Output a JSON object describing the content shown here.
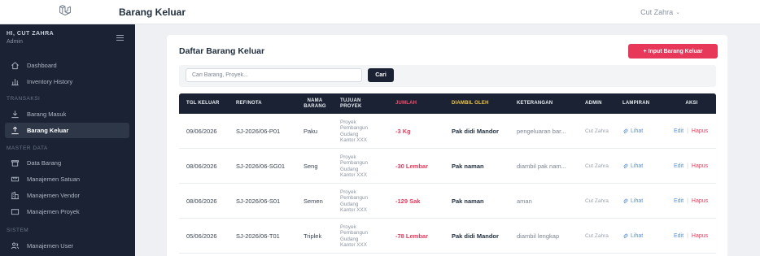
{
  "app": {
    "logo_icon": "laravel-logo-icon",
    "page_heading": "Barang Keluar",
    "user_menu": "Cut Zahra",
    "user_menu_icon": "chevron-down-icon",
    "accent_color": "#e8385a",
    "sidebar_color": "#1a2233"
  },
  "sidebar": {
    "greeting": "HI, CUT ZAHRA",
    "role": "Admin",
    "sections": {
      "transaksi": "TRANSAKSI",
      "master_data": "MASTER DATA",
      "sistem": "SISTEM"
    },
    "items": [
      {
        "label": "Dashboard",
        "icon": "home-icon"
      },
      {
        "label": "Inventory History",
        "icon": "bar-chart-icon"
      },
      {
        "label": "Barang Masuk",
        "icon": "download-icon"
      },
      {
        "label": "Barang Keluar",
        "icon": "upload-icon",
        "active": true
      },
      {
        "label": "Data Barang",
        "icon": "box-icon"
      },
      {
        "label": "Manajemen Satuan",
        "icon": "ruler-icon"
      },
      {
        "label": "Manajemen Vendor",
        "icon": "building-icon"
      },
      {
        "label": "Manajemen Proyek",
        "icon": "folder-icon"
      },
      {
        "label": "Manajemen User",
        "icon": "users-icon"
      }
    ]
  },
  "main": {
    "title": "Daftar Barang Keluar",
    "add_button": "+ Input Barang Keluar",
    "search_placeholder": "Cari Barang, Proyek...",
    "search_button": "Cari",
    "columns": {
      "tgl": "TGL KELUAR",
      "ref": "REF/NOTA",
      "nama": "NAMA\nBARANG",
      "tujuan": "TUJUAN\nPROYEK",
      "jumlah": "JUMLAH",
      "diambil": "DIAMBIL OLEH",
      "keterangan": "KETERANGAN",
      "admin": "ADMIN",
      "lampiran": "LAMPIRAN",
      "aksi": "AKSI"
    },
    "rows": [
      {
        "tgl": "09/06/2026",
        "ref": "SJ-2026/06-P01",
        "nama": "Paku",
        "tujuan": "Proyek\nPembangun\nGudang\nKantor XXX",
        "jumlah": "-3 Kg",
        "diambil": "Pak didi Mandor",
        "keterangan": "pengeluaran bar...",
        "admin": "Cut Zahra",
        "lampiran": "Lihat",
        "edit": "Edit",
        "hapus": "Hapus"
      },
      {
        "tgl": "08/06/2026",
        "ref": "SJ-2026/06-SG01",
        "nama": "Seng",
        "tujuan": "Proyek\nPembangun\nGudang\nKantor XXX",
        "jumlah": "-30 Lembar",
        "diambil": "Pak naman",
        "keterangan": "diambil pak nam...",
        "admin": "Cut Zahra",
        "lampiran": "Lihat",
        "edit": "Edit",
        "hapus": "Hapus"
      },
      {
        "tgl": "08/06/2026",
        "ref": "SJ-2026/06-S01",
        "nama": "Semen",
        "tujuan": "Proyek\nPembangun\nGudang\nKantor XXX",
        "jumlah": "-129 Sak",
        "diambil": "Pak naman",
        "keterangan": "aman",
        "admin": "Cut Zahra",
        "lampiran": "Lihat",
        "edit": "Edit",
        "hapus": "Hapus"
      },
      {
        "tgl": "05/06/2026",
        "ref": "SJ-2026/06-T01",
        "nama": "Triplek",
        "tujuan": "Proyek\nPembangun\nGudang\nKantor XXX",
        "jumlah": "-78 Lembar",
        "diambil": "Pak didi Mandor",
        "keterangan": "diambil lengkap",
        "admin": "Cut Zahra",
        "lampiran": "Lihat",
        "edit": "Edit",
        "hapus": "Hapus"
      }
    ]
  }
}
